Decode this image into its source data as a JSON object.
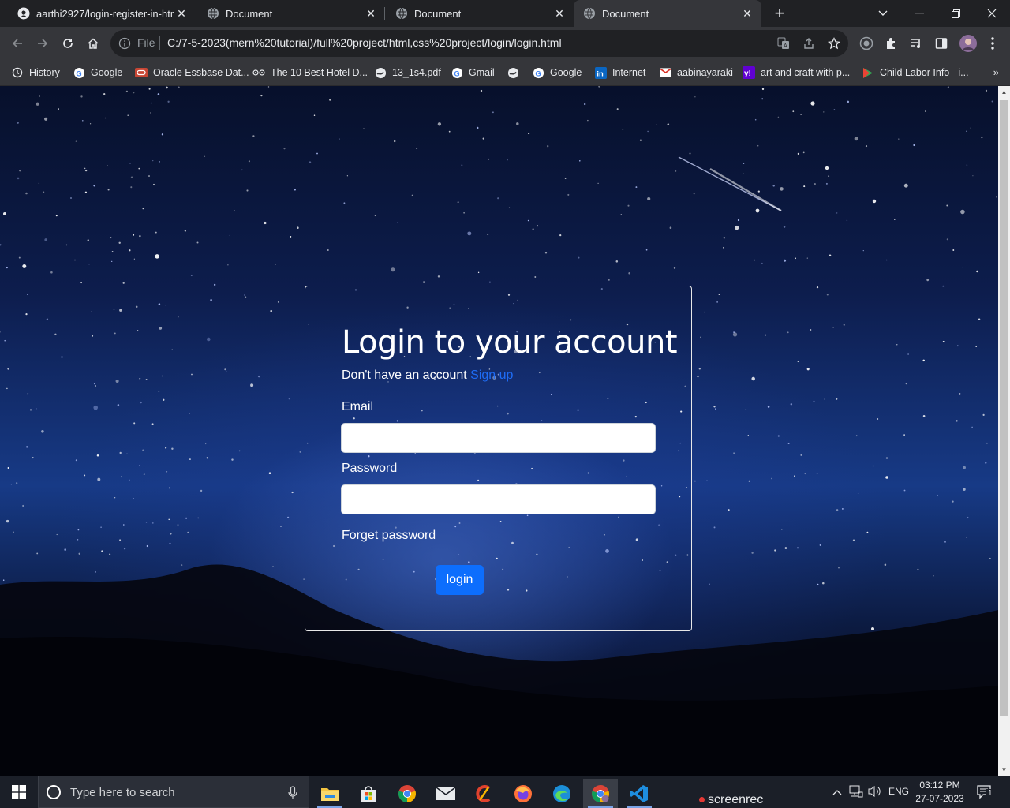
{
  "browser": {
    "tabs": [
      {
        "title": "aarthi2927/login-register-in-html",
        "icon": "github-icon"
      },
      {
        "title": "Document",
        "icon": "globe-icon"
      },
      {
        "title": "Document",
        "icon": "globe-icon"
      },
      {
        "title": "Document",
        "icon": "globe-icon",
        "active": true
      }
    ],
    "omnibox": {
      "scheme_label": "File",
      "url": "C:/7-5-2023(mern%20tutorial)/full%20project/html,css%20project/login/login.html"
    },
    "bookmarks": [
      {
        "label": "History",
        "icon": "history-icon"
      },
      {
        "label": "Google",
        "icon": "google-icon"
      },
      {
        "label": "Oracle Essbase Dat...",
        "icon": "oracle-icon"
      },
      {
        "label": "The 10 Best Hotel D...",
        "icon": "tripadvisor-icon"
      },
      {
        "label": "13_1s4.pdf",
        "icon": "globe-icon"
      },
      {
        "label": "Gmail",
        "icon": "google-icon"
      },
      {
        "label": "",
        "icon": "globe-icon"
      },
      {
        "label": "Google",
        "icon": "google-icon"
      },
      {
        "label": "Internet",
        "icon": "linkedin-icon"
      },
      {
        "label": "aabinayaraki",
        "icon": "gmail-icon"
      },
      {
        "label": "art and craft with p...",
        "icon": "yahoo-icon"
      },
      {
        "label": "Child Labor Info - i...",
        "icon": "play-icon"
      }
    ],
    "bookmarks_overflow": "»"
  },
  "login": {
    "title": "Login to your account",
    "signup_prompt": "Don't have an account",
    "signup_link": "Sign up",
    "email_label": "Email",
    "email_value": "",
    "password_label": "Password",
    "password_value": "",
    "forget_label": "Forget password",
    "login_button": "login"
  },
  "taskbar": {
    "search_placeholder": "Type here to search",
    "screenrec_label": "screenrec",
    "language": "ENG",
    "time": "03:12 PM",
    "date": "27-07-2023",
    "notification_count": "1"
  },
  "colors": {
    "button_primary": "#0d6efd",
    "link": "#1e6cf5",
    "chrome_dark": "#202124",
    "chrome_toolbar": "#35363a"
  }
}
